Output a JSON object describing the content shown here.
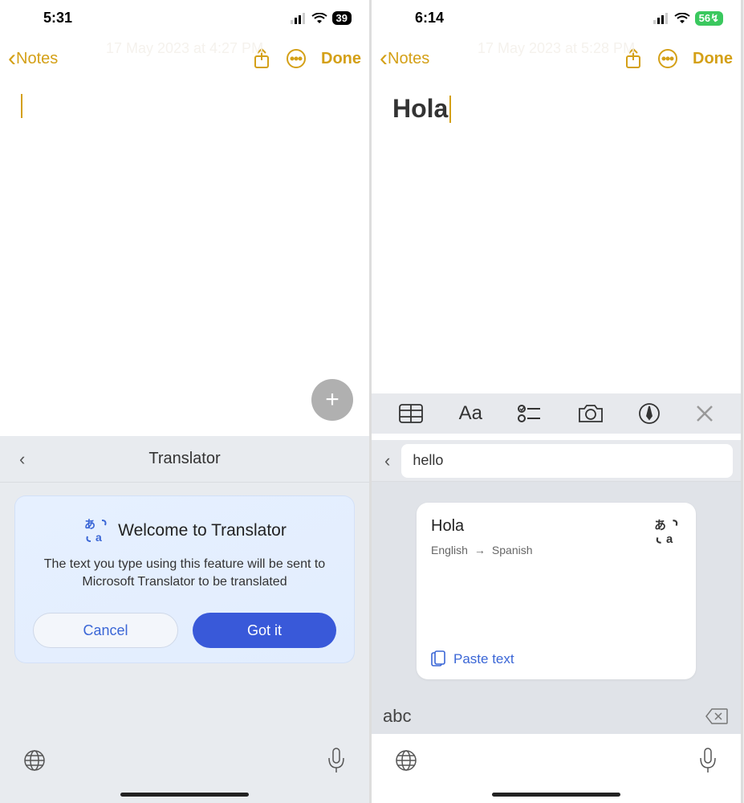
{
  "left": {
    "status": {
      "time": "5:31",
      "battery": "39"
    },
    "nav": {
      "back_label": "Notes",
      "done_label": "Done"
    },
    "ghost_date": "17 May 2023 at 4:27 PM",
    "translator": {
      "header_title": "Translator",
      "welcome_title": "Welcome to Translator",
      "welcome_desc": "The text you type using this feature will be sent to Microsoft Translator to be translated",
      "cancel_label": "Cancel",
      "gotit_label": "Got it"
    }
  },
  "right": {
    "status": {
      "time": "6:14",
      "battery": "56↯"
    },
    "nav": {
      "back_label": "Notes",
      "done_label": "Done"
    },
    "ghost_date": "17 May 2023 at 5:28 PM",
    "note_title": "Hola",
    "translator": {
      "input_value": "hello",
      "result_word": "Hola",
      "src_lang": "English",
      "dst_lang": "Spanish",
      "paste_label": "Paste text"
    },
    "suggestion": "abc"
  }
}
